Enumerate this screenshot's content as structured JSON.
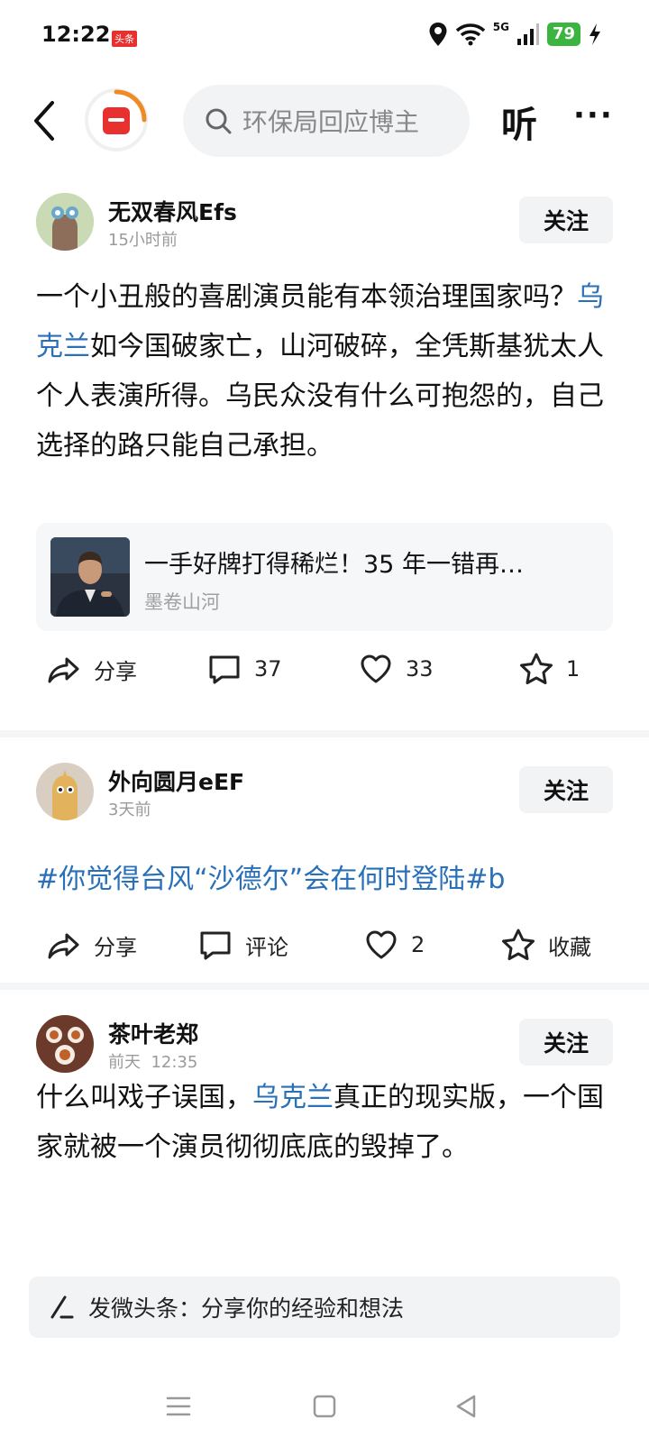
{
  "status_bar": {
    "time": "12:22",
    "app_badge": "头条",
    "battery": "79",
    "network": "5G"
  },
  "header": {
    "search_placeholder": "环保局回应博主",
    "listen_label": "听",
    "more_label": "···"
  },
  "posts": [
    {
      "author": "无双春风Efs",
      "time": "15小时前",
      "follow_label": "关注",
      "body_before": "一个小丑般的喜剧演员能有本领治理国家吗？",
      "body_link": "乌克兰",
      "body_after": "如今国破家亡，山河破碎，全凭斯基犹太人个人表演所得。乌民众没有什么可抱怨的，自己选择的路只能自己承担。",
      "article": {
        "title": "一手好牌打得稀烂！35 年一错再…",
        "source": "墨卷山河"
      },
      "actions": {
        "share": "分享",
        "comments": "37",
        "likes": "33",
        "favorites": "1"
      }
    },
    {
      "author": "外向圆月eEF",
      "time": "3天前",
      "follow_label": "关注",
      "topic": "#你觉得台风“沙德尔”会在何时登陆#",
      "topic_tail": "b",
      "actions": {
        "share": "分享",
        "comments": "评论",
        "likes": "2",
        "favorites": "收藏"
      }
    },
    {
      "author": "茶叶老郑",
      "time": "前天  12:35",
      "follow_label": "关注",
      "body_before": "什么叫戏子误国，",
      "body_link": "乌克兰",
      "body_after": "真正的现实版，一个国家就被一个演员彻彻底底的毁掉了。"
    }
  ],
  "composer": {
    "placeholder": "发微头条：分享你的经验和想法"
  },
  "colors": {
    "link": "#2970b8",
    "brand_red": "#e8312f",
    "battery_green": "#3cb540"
  },
  "icons": [
    "back-arrow-icon",
    "toutiao-logo-icon",
    "search-icon",
    "share-icon",
    "comment-icon",
    "heart-icon",
    "star-icon",
    "pen-icon",
    "menu-icon",
    "home-square-icon",
    "back-triangle-icon"
  ]
}
